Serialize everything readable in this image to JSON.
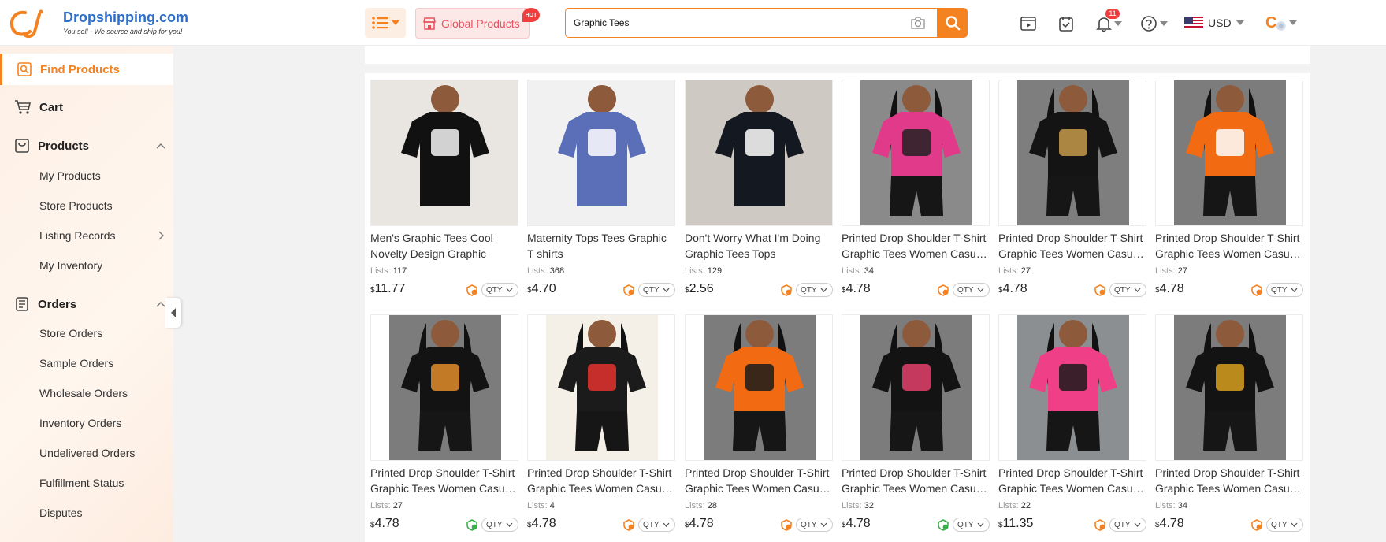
{
  "header": {
    "logo_text": "Dropshipping.com",
    "logo_tagline": "You sell - We source and ship for you!",
    "global_products_label": "Global Products",
    "hot_badge": "HOT",
    "search_value": "Graphic Tees",
    "notification_count": "11",
    "currency": "USD",
    "avatar_initial": "C",
    "accent_color": "#f58220"
  },
  "sidebar": {
    "find_products": "Find Products",
    "cart": "Cart",
    "products": "Products",
    "product_items": [
      "My Products",
      "Store Products",
      "Listing Records",
      "My Inventory"
    ],
    "orders": "Orders",
    "order_items": [
      "Store Orders",
      "Sample Orders",
      "Wholesale Orders",
      "Inventory Orders",
      "Undelivered Orders",
      "Fulfillment Status",
      "Disputes"
    ]
  },
  "product_labels": {
    "lists_prefix": "Lists: ",
    "currency_symbol": "$",
    "qty_label": "QTY"
  },
  "products": [
    {
      "title": "Men's Graphic Tees Cool Novelty Design Graphic",
      "lists": "117",
      "price": "11.77",
      "ship": "orange",
      "image": "man-black-tee-bulb"
    },
    {
      "title": "Maternity Tops Tees Graphic T shirts",
      "lists": "368",
      "price": "4.70",
      "ship": "orange",
      "image": "blue-mama-bear-top"
    },
    {
      "title": "Don't Worry What I'm Doing Graphic Tees Tops",
      "lists": "129",
      "price": "2.56",
      "ship": "orange",
      "image": "flatlay-dont-worry-tee"
    },
    {
      "title": "Printed Drop Shoulder T-Shirt Graphic Tees Women Casual Sets",
      "lists": "34",
      "price": "4.78",
      "ship": "orange",
      "image": "pink-she-set"
    },
    {
      "title": "Printed Drop Shoulder T-Shirt Graphic Tees Women Casual Sets",
      "lists": "27",
      "price": "4.78",
      "ship": "orange",
      "image": "black-heart-set"
    },
    {
      "title": "Printed Drop Shoulder T-Shirt Graphic Tees Women Casual Sets",
      "lists": "27",
      "price": "4.78",
      "ship": "orange",
      "image": "orange-it-is-set"
    },
    {
      "title": "Printed Drop Shoulder T-Shirt Graphic Tees Women Casual Sets",
      "lists": "27",
      "price": "4.78",
      "ship": "green",
      "image": "black-butterfly-set"
    },
    {
      "title": "Printed Drop Shoulder T-Shirt Graphic Tees Women Casual Sets",
      "lists": "4",
      "price": "4.78",
      "ship": "orange",
      "image": "queen-card-set"
    },
    {
      "title": "Printed Drop Shoulder T-Shirt Graphic Tees Women Casual Sets",
      "lists": "28",
      "price": "4.78",
      "ship": "orange",
      "image": "orange-butterfly-set"
    },
    {
      "title": "Printed Drop Shoulder T-Shirt Graphic Tees Women Casual Sets",
      "lists": "32",
      "price": "4.78",
      "ship": "green",
      "image": "black-lips-set"
    },
    {
      "title": "Printed Drop Shoulder T-Shirt Graphic Tees Women Casual Sets",
      "lists": "22",
      "price": "11.35",
      "ship": "orange",
      "image": "pink-blessed-set"
    },
    {
      "title": "Printed Drop Shoulder T-Shirt Graphic Tees Women Casual Sets",
      "lists": "34",
      "price": "4.78",
      "ship": "orange",
      "image": "black-rose-set"
    }
  ]
}
